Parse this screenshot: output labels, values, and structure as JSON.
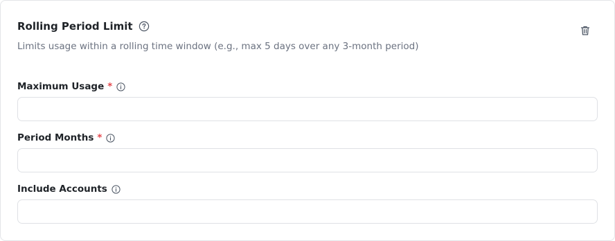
{
  "card": {
    "title": "Rolling Period Limit",
    "subtitle": "Limits usage within a rolling time window (e.g., max 5 days over any 3-month period)"
  },
  "fields": [
    {
      "label": "Maximum Usage",
      "required_mark": "*",
      "value": "",
      "placeholder": ""
    },
    {
      "label": "Period Months",
      "required_mark": "*",
      "value": "",
      "placeholder": ""
    },
    {
      "label": "Include Accounts",
      "value": "",
      "placeholder": ""
    }
  ],
  "icons": {
    "help": "question-circle-icon",
    "info": "info-circle-icon",
    "delete": "trash-icon"
  },
  "colors": {
    "required": "#e5484d",
    "text": "#1f2328",
    "muted": "#6b7280",
    "border": "#dfe1e5"
  }
}
